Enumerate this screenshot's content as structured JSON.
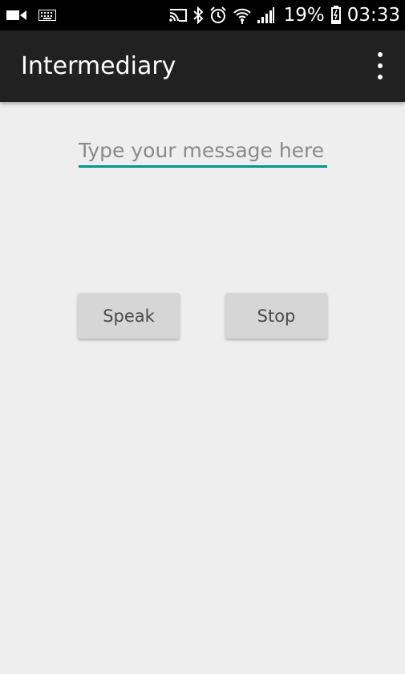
{
  "status_bar": {
    "icons": [
      "video-camera-icon",
      "keyboard-icon",
      "cast-icon",
      "bluetooth-icon",
      "alarm-icon",
      "wifi-icon",
      "signal-icon",
      "battery-icon"
    ],
    "battery_percent": "19%",
    "time": "03:33"
  },
  "app_bar": {
    "title": "Intermediary",
    "menu_icon": "overflow-menu-icon"
  },
  "form": {
    "message_value": "",
    "message_placeholder": "Type your message here",
    "speak_label": "Speak",
    "stop_label": "Stop"
  },
  "colors": {
    "status_bar": "#000000",
    "app_bar": "#212121",
    "background": "#eeeeee",
    "accent": "#009688",
    "button": "#d6d6d6"
  }
}
